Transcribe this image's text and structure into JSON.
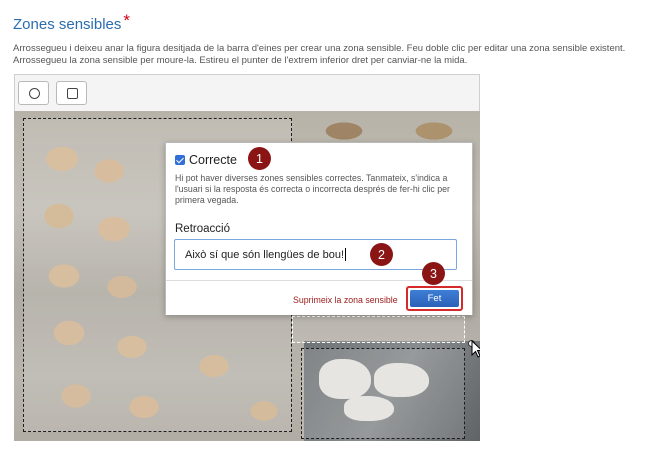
{
  "section": {
    "title": "Zones sensibles",
    "required_mark": "*",
    "help_text": "Arrossegueu i deixeu anar la figura desitjada de la barra d'eines per crear una zona sensible. Feu doble clic per editar una zona sensible existent. Arrossegueu la zona sensible per moure-la. Estireu el punter de l'extrem inferior dret per canviar-ne la mida."
  },
  "toolbar": {
    "tools": [
      {
        "icon": "circle-icon",
        "name": "circle-tool"
      },
      {
        "icon": "rectangle-icon",
        "name": "rectangle-tool"
      }
    ]
  },
  "popup": {
    "correct_label": "Correcte",
    "correct_checked": true,
    "correct_help": "Hi pot haver diverses zones sensibles correctes. Tanmateix, s'indica a l'usuari si la resposta és correcta o incorrecta després de fer-hi clic per primera vegada.",
    "feedback_label": "Retroacció",
    "feedback_value": "Això sí que són llengües de bou!",
    "delete_label": "Suprimeix la zona sensible",
    "done_label": "Fet"
  },
  "callouts": [
    "1",
    "2",
    "3"
  ],
  "colors": {
    "heading": "#2b6cb0",
    "required": "#d0021b",
    "callout": "#8b1515",
    "primary_button": "#2f6fd6",
    "delete_link": "#9b1b1b"
  }
}
